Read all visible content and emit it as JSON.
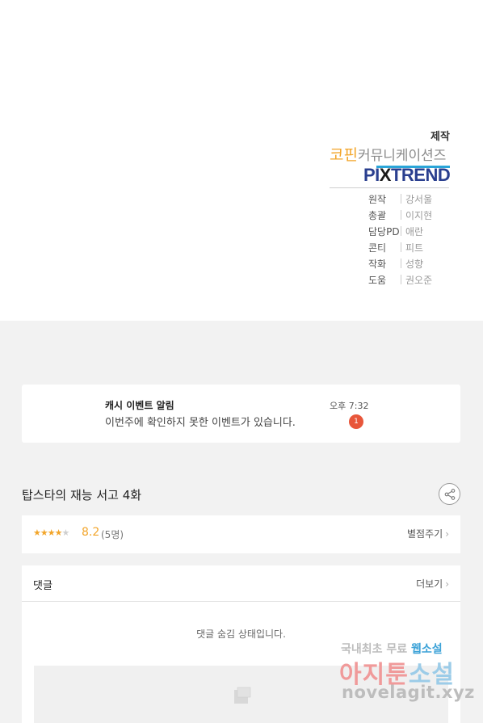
{
  "credits": {
    "producer_label": "제작",
    "logo_kopin_a": "코핀",
    "logo_kopin_b": "커뮤니케이션즈",
    "logo_pixtrend_a": "PI",
    "logo_pixtrend_x": "X",
    "logo_pixtrend_b": "TREND",
    "rows": [
      {
        "role": "원작",
        "name": "강서울"
      },
      {
        "role": "총괄",
        "name": "이지현"
      },
      {
        "role": "담당PD",
        "name": "애란"
      },
      {
        "role": "콘티",
        "name": "피트"
      },
      {
        "role": "작화",
        "name": "성향"
      },
      {
        "role": "도움",
        "name": "권오준"
      }
    ]
  },
  "notice": {
    "title": "캐시 이벤트 알림",
    "message": "이번주에 확인하지 못한 이벤트가 있습니다.",
    "time": "오후 7:32",
    "badge_count": "1",
    "badge_color": "#e8563a"
  },
  "episode": {
    "title": "탑스타의 재능 서고 4화",
    "share_icon": "share-icon"
  },
  "rating": {
    "stars_filled": 4,
    "stars_total": 5,
    "score": "8.2",
    "count": "(5명)",
    "rate_label": "별점주기",
    "accent_color": "#f2a52a"
  },
  "comments": {
    "title": "댓글",
    "more_label": "더보기",
    "hidden_notice": "댓글 숨김 상태입니다."
  },
  "watermark": {
    "line1_a": "국내최초 무료",
    "line1_b": "웹소설",
    "line2_a": "아지툰",
    "line2_b": "소설",
    "line3": "novelagit.xyz"
  }
}
